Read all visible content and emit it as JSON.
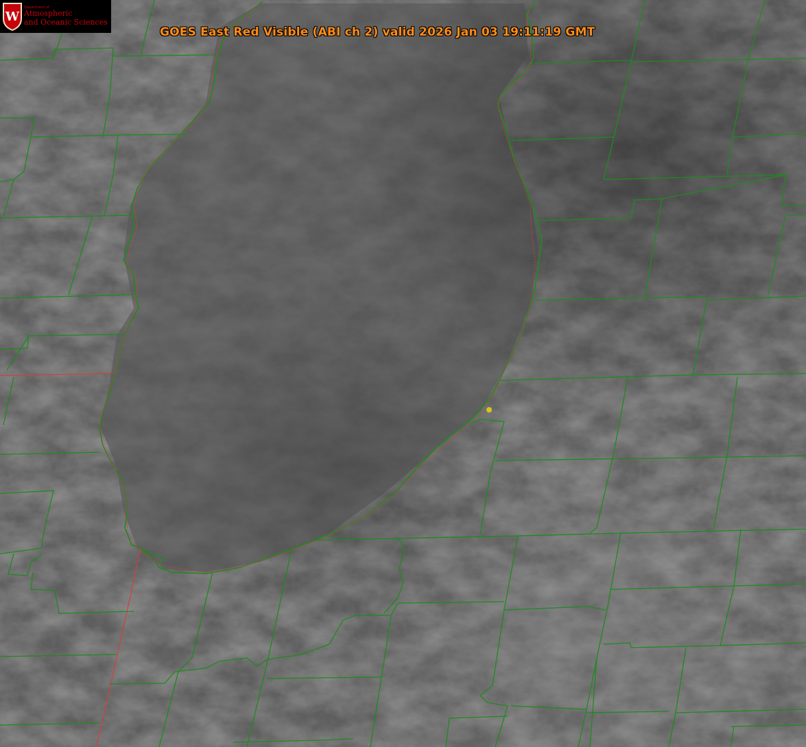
{
  "title": "GOES East Red Visible (ABI ch 2) valid 2026 Jan 03 19:11:19 GMT",
  "logo": {
    "dept": "Department of",
    "line1": "Atmospheric",
    "line2": "and Oceanic Sciences",
    "crest_letter": "W"
  },
  "colors": {
    "title": "#ff8c1a",
    "county_lines": "#1f8a1f",
    "state_line": "#d04040",
    "marker": "#d4c81a",
    "logo_red": "#c5050c"
  },
  "icons": {
    "crest": "uw-crest-icon",
    "marker": "location-dot-icon"
  }
}
